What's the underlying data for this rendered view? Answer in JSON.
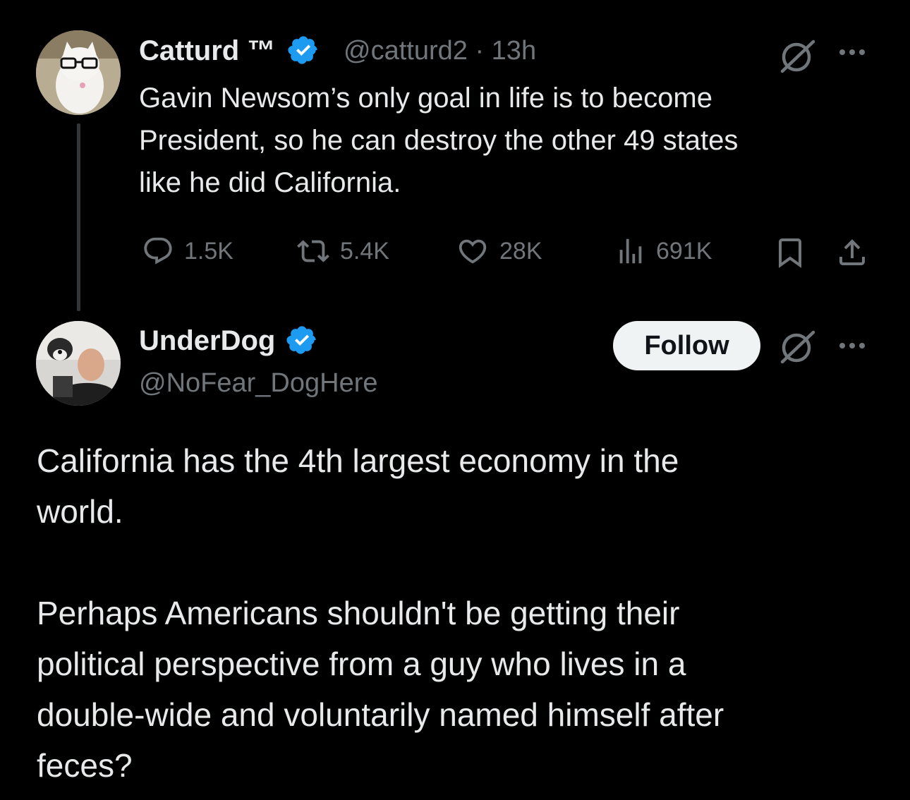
{
  "tweet1": {
    "name": "Catturd ™",
    "handle": "@catturd2",
    "separator": "·",
    "time": "13h",
    "text_line1": "Gavin Newsom’s only goal in life is to become",
    "text_line2": "President, so he can destroy the other 49 states",
    "text_line3": "like he did California.",
    "replies": "1.5K",
    "reposts": "5.4K",
    "likes": "28K",
    "views": "691K"
  },
  "tweet2": {
    "name": "UnderDog",
    "handle": "@NoFear_DogHere",
    "follow_label": "Follow",
    "para1_line1": "California has the 4th largest economy in the",
    "para1_line2": "world.",
    "para2_line1": "Perhaps Americans shouldn't be getting their",
    "para2_line2": "political perspective from a guy who lives in a",
    "para2_line3": "double-wide and voluntarily named himself after",
    "para2_line4": "feces?"
  },
  "colors": {
    "background": "#000000",
    "text": "#e7e9ea",
    "muted": "#71767b",
    "verified": "#1d9bf0",
    "follow_bg": "#eff3f4"
  },
  "icons": [
    "reply-icon",
    "repost-icon",
    "like-icon",
    "views-icon",
    "bookmark-icon",
    "share-icon",
    "grok-icon",
    "more-icon",
    "verified-badge-icon"
  ]
}
